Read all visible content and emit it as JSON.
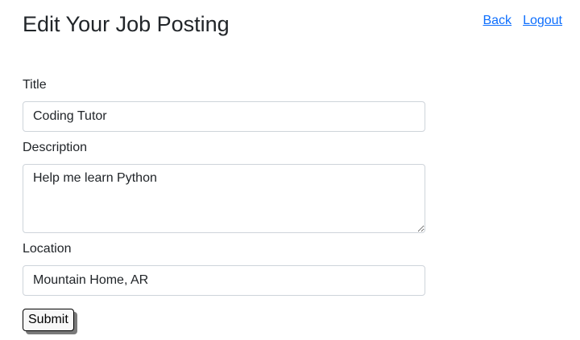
{
  "header": {
    "title": "Edit Your Job Posting",
    "nav": {
      "back_label": "Back",
      "logout_label": "Logout"
    }
  },
  "form": {
    "title": {
      "label": "Title",
      "value": "Coding Tutor"
    },
    "description": {
      "label": "Description",
      "value": "Help me learn Python"
    },
    "location": {
      "label": "Location",
      "value": "Mountain Home, AR"
    },
    "submit_label": "Submit"
  },
  "colors": {
    "link": "#0d6efd",
    "text": "#212529",
    "input_border": "#ced4da"
  }
}
